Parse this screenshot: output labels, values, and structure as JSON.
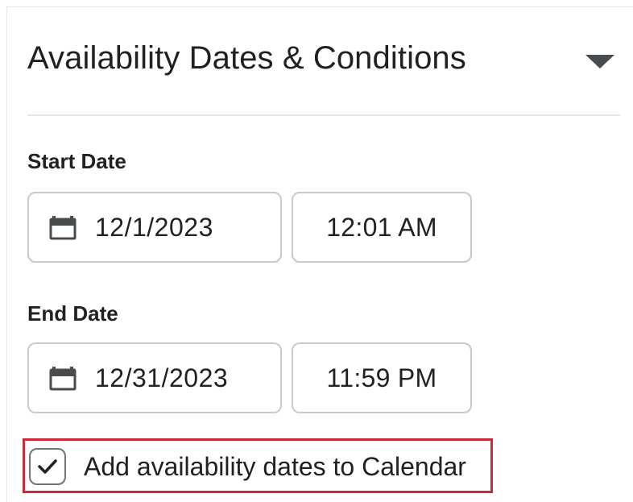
{
  "section": {
    "title": "Availability Dates & Conditions",
    "toggle_icon": "caret-down-icon"
  },
  "start": {
    "label": "Start Date",
    "date": "12/1/2023",
    "time": "12:01 AM",
    "date_icon": "calendar-icon"
  },
  "end": {
    "label": "End Date",
    "date": "12/31/2023",
    "time": "11:59 PM",
    "date_icon": "calendar-icon"
  },
  "calendar_option": {
    "label": "Add availability dates to Calendar",
    "checked": true,
    "highlighted": true
  },
  "colors": {
    "highlight": "#cc2936",
    "text": "#202122",
    "border": "#c7cacd"
  }
}
